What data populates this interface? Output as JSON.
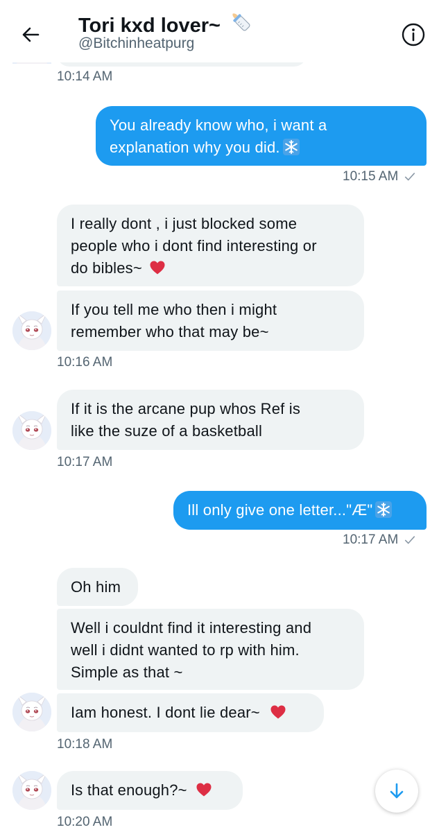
{
  "header": {
    "title": "Tori kxd lover~",
    "handle": "@Bitchinheatpurg"
  },
  "messages": [
    {
      "side": "in",
      "time": "10:14 AM"
    },
    {
      "side": "out",
      "lines": [
        "You already know who, i want a",
        "explanation why you did."
      ],
      "time": "10:15 AM"
    },
    {
      "side": "in",
      "lines": [
        "I really dont , i just blocked some",
        "people who i dont find interesting or",
        "do bibles~"
      ]
    },
    {
      "side": "in",
      "lines": [
        "If you tell me who then i might",
        "remember who that may be~"
      ],
      "time": "10:16 AM"
    },
    {
      "side": "in",
      "lines": [
        "If it is the arcane pup whos Ref is",
        "like the suze of a basketball"
      ],
      "time": "10:17 AM"
    },
    {
      "side": "out",
      "lines": [
        "Ill only give one letter...\"Æ\""
      ],
      "time": "10:17 AM"
    },
    {
      "side": "in",
      "lines": [
        "Oh him"
      ]
    },
    {
      "side": "in",
      "lines": [
        "Well i couldnt find it interesting  and",
        "well i didnt wanted to rp with him.",
        "Simple as that ~"
      ]
    },
    {
      "side": "in",
      "lines": [
        "Iam honest. I dont lie dear~"
      ],
      "time": "10:18 AM"
    },
    {
      "side": "in",
      "lines": [
        "Is that enough?~"
      ],
      "time": "10:20 AM"
    }
  ],
  "colors": {
    "outgoing_bubble": "#1d9bf0",
    "incoming_bubble": "#eff3f4",
    "secondary_text": "#536471",
    "heart": "#dd2e44"
  },
  "icons": [
    "back-arrow-icon",
    "baby-bottle-icon",
    "info-icon",
    "snowflake-icon",
    "heart-icon",
    "read-check-icon",
    "scroll-down-arrow-icon"
  ]
}
